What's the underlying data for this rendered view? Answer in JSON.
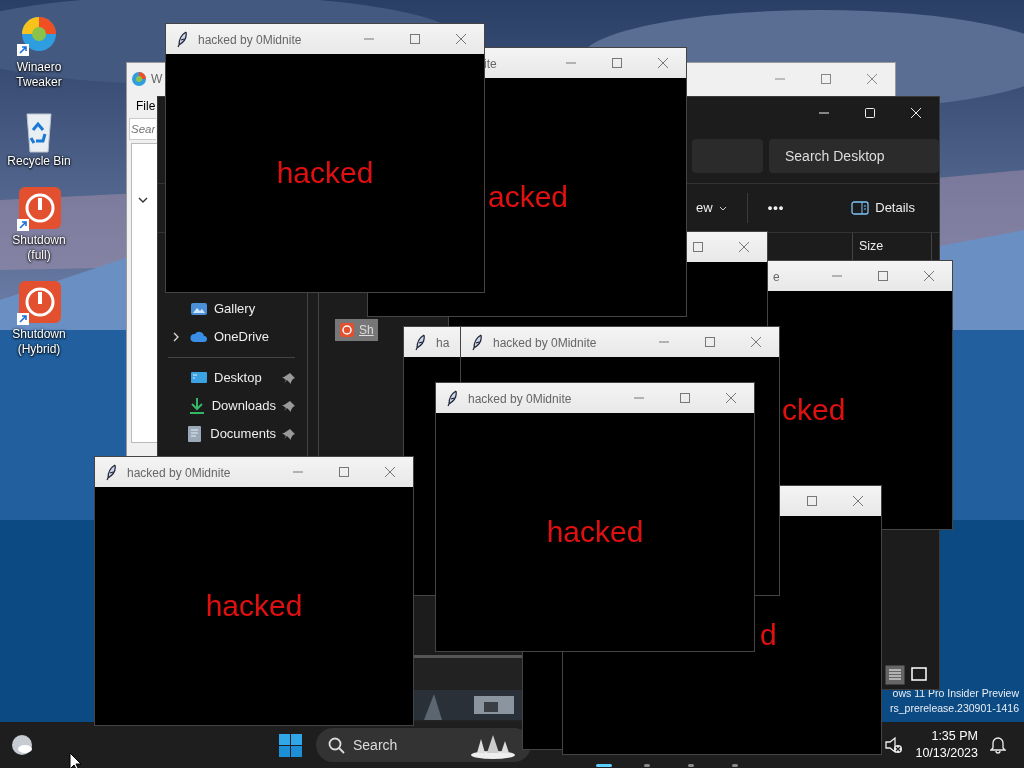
{
  "desktop_icons": [
    {
      "label": "Winaero Tweaker",
      "kind": "tweaker"
    },
    {
      "label": "Recycle Bin",
      "kind": "bin"
    },
    {
      "label": "Shutdown (full)",
      "kind": "power"
    },
    {
      "label": "Shutdown (Hybrid)",
      "kind": "power"
    }
  ],
  "tweaker_window": {
    "title": "W",
    "menu": [
      "File"
    ],
    "search": {
      "placeholder": "Sear"
    }
  },
  "explorer": {
    "search": {
      "placeholder": "Search Desktop"
    },
    "view_button": "ew",
    "more_button": "•••",
    "details_button": "Details",
    "columns": [
      "Size"
    ],
    "nav_top": [
      {
        "label": "Gallery",
        "kind": "gallery",
        "has_children": false
      },
      {
        "label": "OneDrive",
        "kind": "cloud",
        "has_children": true
      }
    ],
    "quick_access": [
      {
        "label": "Desktop",
        "kind": "desktop",
        "pinned": true
      },
      {
        "label": "Downloads",
        "kind": "download",
        "pinned": true
      },
      {
        "label": "Documents",
        "kind": "documents",
        "pinned": true
      }
    ],
    "items": [
      {
        "label": "Sh",
        "selected": true
      }
    ]
  },
  "taskbar": {
    "search": "Search",
    "apps": [
      {
        "active": true
      },
      {
        "active": false
      },
      {
        "active": false
      },
      {
        "active": false
      }
    ],
    "time": "1:35 PM",
    "date": "10/13/2023"
  },
  "watermark": [
    "ows 11 Pro Insider Preview",
    "rs_prerelease.230901-1416"
  ],
  "hacked_windows": [
    {
      "kind": "tk",
      "title": "hacked by 0Midnite",
      "text": "hacked"
    },
    {
      "kind": "tk",
      "title": "ite",
      "text": "acked"
    },
    {
      "kind": "tk",
      "title": "hacked by 0Midnite",
      "text": "hacked"
    },
    {
      "kind": "tk"
    },
    {
      "kind": "tk",
      "title": "ha"
    },
    {
      "kind": "tk",
      "title": "hacked by 0Midnite"
    },
    {
      "kind": "tk",
      "title": "hacked by 0Midnite",
      "text": "hacked"
    },
    {
      "kind": "tk",
      "title": "e",
      "text": "cked"
    },
    {
      "kind": "blank"
    },
    {
      "kind": "tk",
      "text": "d"
    }
  ]
}
